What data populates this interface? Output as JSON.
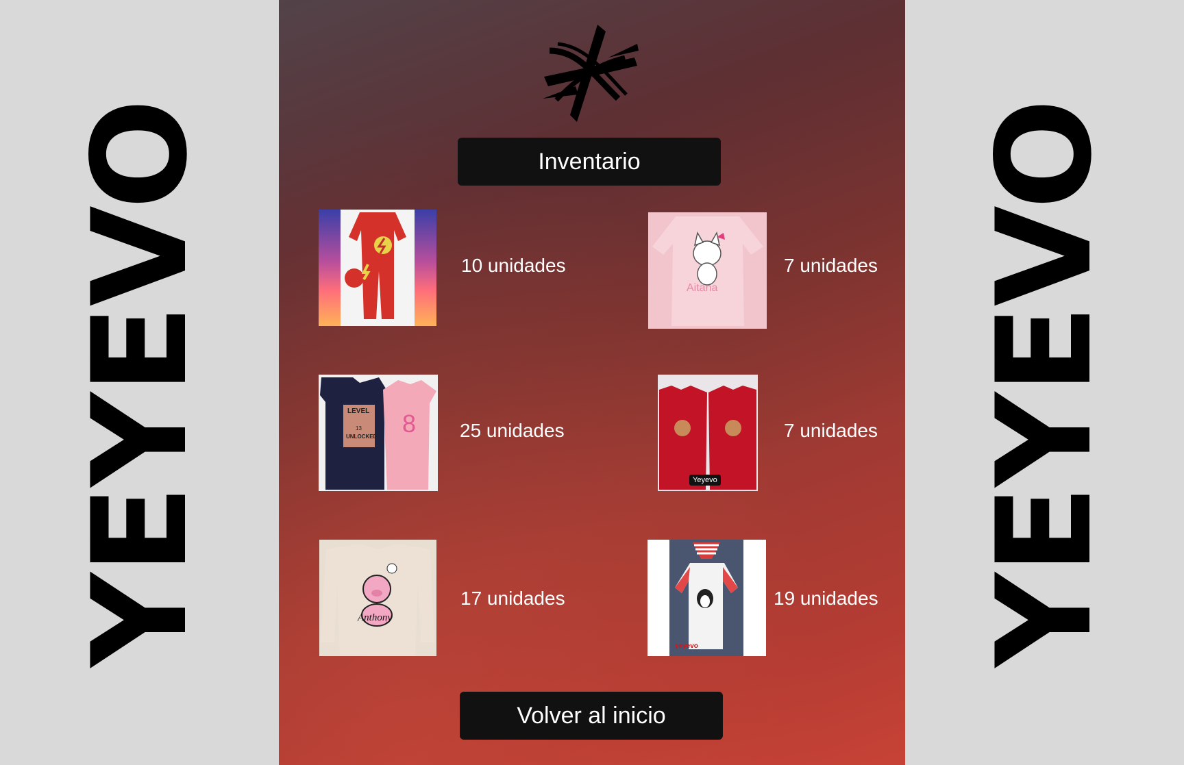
{
  "brand": {
    "name": "YEYEVO"
  },
  "header": {
    "inventory_label": "Inventario"
  },
  "footer": {
    "back_label": "Volver al inicio"
  },
  "products": [
    {
      "quantity": "10 unidades",
      "image": "red flash baby onesie"
    },
    {
      "quantity": "7 unidades",
      "image": "pink cat onesie"
    },
    {
      "quantity": "25 unidades",
      "image": "level unlocked shirts"
    },
    {
      "quantity": "7 unidades",
      "image": "red reindeer sweaters"
    },
    {
      "quantity": "17 unidades",
      "image": "beige pig sweater"
    },
    {
      "quantity": "19 unidades",
      "image": "penguin striped onesie"
    }
  ],
  "image_text": {
    "product_2": "Aitana",
    "product_3_level": "LEVEL",
    "product_3_number": "13",
    "product_3_unlocked": "UNLOCKED",
    "product_4_tag": "Yeyevo",
    "product_5_name": "Anthony",
    "product_6_tag": "yeyevo"
  }
}
